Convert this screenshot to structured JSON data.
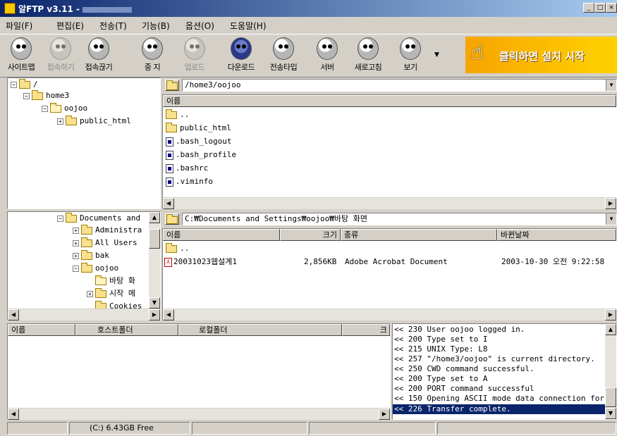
{
  "window": {
    "title": "알FTP v3.11 -"
  },
  "menu": [
    "파일(F)",
    "편집(E)",
    "전송(T)",
    "기능(B)",
    "옵션(O)",
    "도움말(H)"
  ],
  "toolbar": {
    "items": [
      {
        "label": "사이트맵",
        "icon": "site-map-icon",
        "enabled": true
      },
      {
        "label": "접속하기",
        "icon": "connect-icon",
        "enabled": false
      },
      {
        "label": "접속끊기",
        "icon": "disconnect-icon",
        "enabled": true
      },
      {
        "label": "중 지",
        "icon": "stop-icon",
        "enabled": true
      },
      {
        "label": "업로드",
        "icon": "upload-icon",
        "enabled": false
      },
      {
        "label": "다운로드",
        "icon": "download-icon",
        "enabled": true
      },
      {
        "label": "전송타입",
        "icon": "transfer-type-icon",
        "enabled": true
      },
      {
        "label": "서버",
        "icon": "server-icon",
        "enabled": true
      },
      {
        "label": "새로고침",
        "icon": "refresh-icon",
        "enabled": true
      },
      {
        "label": "보기",
        "icon": "view-icon",
        "enabled": true
      }
    ],
    "banner": "클릭하면 설치 시작"
  },
  "remote": {
    "tree": [
      {
        "label": "/",
        "toggle": "⊟"
      },
      {
        "label": "home3",
        "toggle": "⊟"
      },
      {
        "label": "oojoo",
        "toggle": "⊟"
      },
      {
        "label": "public_html",
        "toggle": "⊞"
      }
    ],
    "path": "/home3/oojoo",
    "column": "이름",
    "files": [
      {
        "name": "..",
        "type": "folder"
      },
      {
        "name": "public_html",
        "type": "folder"
      },
      {
        "name": ".bash_logout",
        "type": "file"
      },
      {
        "name": ".bash_profile",
        "type": "file"
      },
      {
        "name": ".bashrc",
        "type": "file"
      },
      {
        "name": ".viminfo",
        "type": "file"
      }
    ]
  },
  "local": {
    "tree": [
      {
        "label": "Documents and",
        "toggle": "⊟"
      },
      {
        "label": "Administra",
        "toggle": "⊞"
      },
      {
        "label": "All Users",
        "toggle": "⊞"
      },
      {
        "label": "bak",
        "toggle": "⊞"
      },
      {
        "label": "oojoo",
        "toggle": "⊟"
      },
      {
        "label": "바탕 화",
        "toggle": ""
      },
      {
        "label": "시작 메",
        "toggle": "⊞"
      },
      {
        "label": "Cookies",
        "toggle": ""
      }
    ],
    "path": "C:₩Documents and Settings₩oojoo₩바탕 화면",
    "columns": [
      "이름",
      "크기",
      "종류",
      "바뀐날짜"
    ],
    "files": [
      {
        "name": "..",
        "size": "",
        "kind": "",
        "date": "",
        "type": "folder"
      },
      {
        "name": "20031023웹설계1",
        "size": "2,856KB",
        "kind": "Adobe Acrobat Document",
        "date": "2003-10-30 오전 9:22:58",
        "type": "pdf"
      }
    ]
  },
  "queue": {
    "columns": [
      "이름",
      "호스트폴더",
      "로컬폴더",
      "크"
    ]
  },
  "log": [
    "<< 230 User oojoo logged in.",
    "<< 200 Type set to I",
    "<< 215 UNIX Type: L8",
    "<< 257 \"/home3/oojoo\" is current directory.",
    "<< 250 CWD command successful.",
    "<< 200 Type set to A",
    "<< 200 PORT command successful",
    "<< 150 Opening ASCII mode data connection for",
    "<< 226 Transfer complete."
  ],
  "status": {
    "drive": "(C:) 6.43GB Free"
  }
}
